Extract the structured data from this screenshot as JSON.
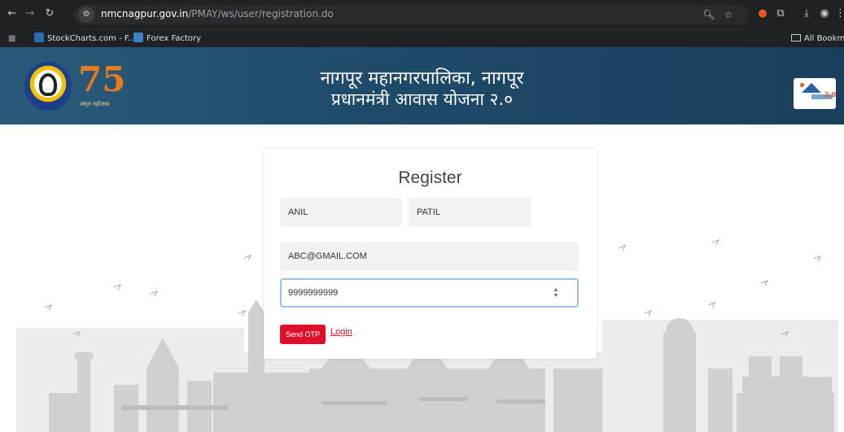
{
  "browser": {
    "url_host": "nmcnagpur.gov.in",
    "url_path": "/PMAY/ws/user/registration.do",
    "bookmarks": [
      {
        "label": "StockCharts.com - F..."
      },
      {
        "label": "Forex Factory"
      }
    ],
    "all_bookmarks_label": "All Bookmarks"
  },
  "header": {
    "title_line1": "नागपूर महानगरपालिका, नागपूर",
    "title_line2": "प्रधानमंत्री आवास योजना २.०",
    "logo2_number": "75",
    "logo2_caption": "अमृत महोत्सव",
    "logo3_number": "2.0"
  },
  "form": {
    "heading": "Register",
    "first_name": "ANIL",
    "last_name": "PATIL",
    "email": "ABC@GMAIL.COM",
    "mobile": "9999999999",
    "send_otp_label": "Send OTP",
    "login_label": "Login"
  },
  "colors": {
    "banner": "#1f4a69",
    "button": "#e0102a",
    "focus_border": "#9cc1ea"
  }
}
